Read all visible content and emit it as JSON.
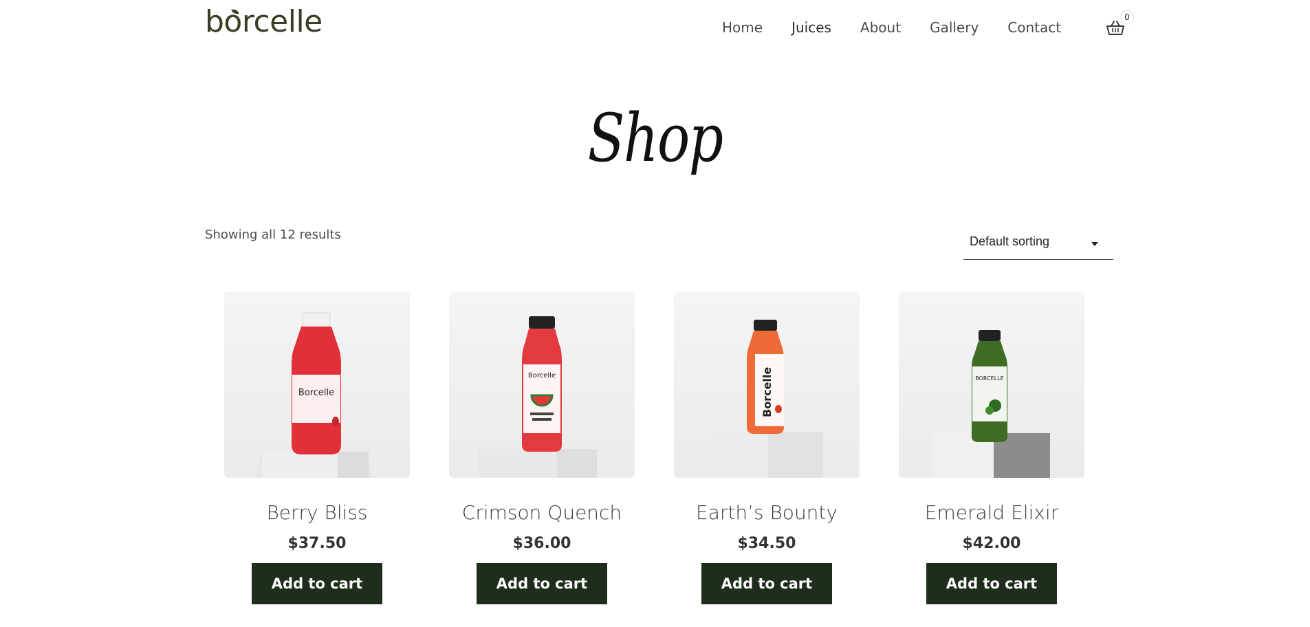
{
  "brand": {
    "logo_text": "borcelle",
    "color": "#3a3e26"
  },
  "nav": {
    "items": [
      {
        "label": "Home"
      },
      {
        "label": "Juices"
      },
      {
        "label": "About"
      },
      {
        "label": "Gallery"
      },
      {
        "label": "Contact"
      }
    ],
    "cart_count": "0",
    "cart_icon": "basket-icon"
  },
  "page": {
    "title": "Shop"
  },
  "toolbar": {
    "result_count": "Showing all 12 results",
    "sort_selected": "Default sorting"
  },
  "products": [
    {
      "name": "Berry Bliss",
      "price": "$37.50",
      "button": "Add to cart",
      "bottle_color": "#e2303a",
      "cap_color": "#f0f0f0",
      "label_text": "Borcelle"
    },
    {
      "name": "Crimson Quench",
      "price": "$36.00",
      "button": "Add to cart",
      "bottle_color": "#e23a3e",
      "cap_color": "#222222",
      "label_text": "Borcelle"
    },
    {
      "name": "Earth’s Bounty",
      "price": "$34.50",
      "button": "Add to cart",
      "bottle_color": "#ee6a36",
      "cap_color": "#222222",
      "label_text": "Borcelle"
    },
    {
      "name": "Emerald Elixir",
      "price": "$42.00",
      "button": "Add to cart",
      "bottle_color": "#3f6b24",
      "cap_color": "#222222",
      "label_text": "BORCELLE"
    }
  ],
  "colors": {
    "button_bg": "#1f2e1c",
    "button_text": "#ffffff"
  }
}
